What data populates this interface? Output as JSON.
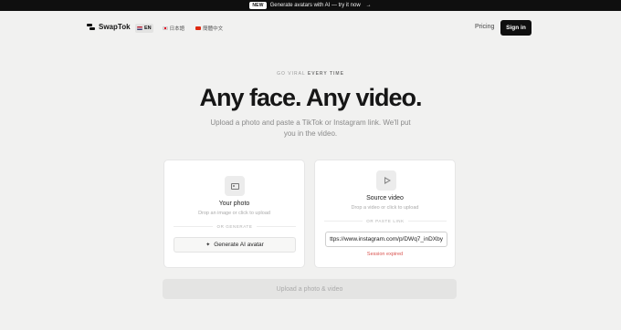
{
  "announcement": {
    "badge": "NEW",
    "text": "Generate avatars with AI — try it now",
    "arrow": "→"
  },
  "nav": {
    "brand": "SwapTok",
    "brand_icon": "swaptok-logo-icon",
    "languages": [
      {
        "code": "EN",
        "label": "EN",
        "flag": "flag-en-icon",
        "active": true
      },
      {
        "code": "JA",
        "label": "日本語",
        "flag": "flag-jp-icon",
        "active": false
      },
      {
        "code": "ZH",
        "label": "簡體中文",
        "flag": "flag-cn-icon",
        "active": false
      }
    ],
    "pricing": "Pricing",
    "signin": "Sign in"
  },
  "hero": {
    "eyebrow_a": "GO VIRAL",
    "eyebrow_b": "EVERY TIME",
    "headline": "Any face. Any video.",
    "subtitle": "Upload a photo and paste a TikTok or Instagram link. We'll put you in the video."
  },
  "photo_card": {
    "icon": "image-icon",
    "title": "Your photo",
    "hint": "Drop an image or click to upload",
    "divider": "OR GENERATE",
    "generate_label": "Generate AI avatar",
    "generate_icon": "sparkle-icon"
  },
  "video_card": {
    "icon": "play-icon",
    "title": "Source video",
    "hint": "Drop a video or click to upload",
    "divider": "OR PASTE LINK",
    "link_value": "https://www.instagram.com/p/DWq7_inDXby/",
    "error": "Session expired"
  },
  "submit": {
    "label": "Upload a photo & video"
  },
  "colors": {
    "background": "#f1f1f0",
    "primary": "#0f0f0f",
    "error": "#d9534f",
    "disabled": "#e4e4e3"
  }
}
